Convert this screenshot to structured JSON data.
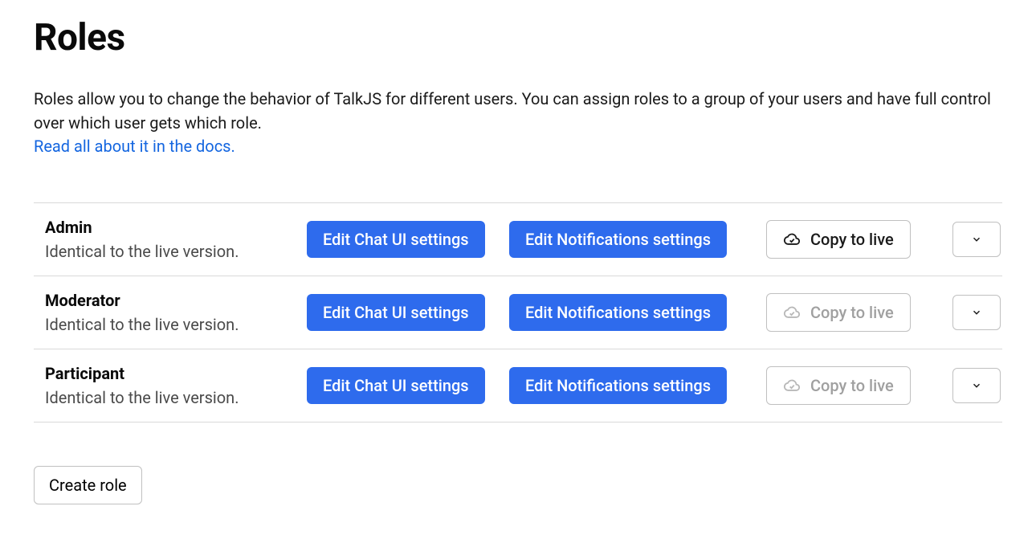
{
  "page": {
    "title": "Roles",
    "intro": "Roles allow you to change the behavior of TalkJS for different users. You can assign roles to a group of your users and have full control over which user gets which role.",
    "docs_link_label": "Read all about it in the docs."
  },
  "labels": {
    "edit_chat_ui": "Edit Chat UI settings",
    "edit_notifications": "Edit Notifications settings",
    "copy_to_live": "Copy to live",
    "create_role": "Create role"
  },
  "roles": [
    {
      "name": "Admin",
      "status": "Identical to the live version.",
      "copy_enabled": true
    },
    {
      "name": "Moderator",
      "status": "Identical to the live version.",
      "copy_enabled": false
    },
    {
      "name": "Participant",
      "status": "Identical to the live version.",
      "copy_enabled": false
    }
  ],
  "colors": {
    "primary": "#2e6bed",
    "link": "#1466e0",
    "border": "#d9d9d9",
    "muted": "#a0a0a0"
  }
}
